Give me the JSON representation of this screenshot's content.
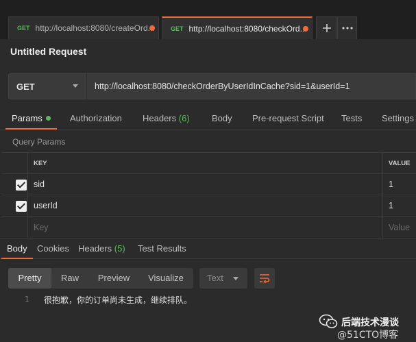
{
  "tabs": [
    {
      "method": "GET",
      "url": "http://localhost:8080/createOrd...",
      "unsaved": true,
      "active": false
    },
    {
      "method": "GET",
      "url": "http://localhost:8080/checkOrd...",
      "unsaved": true,
      "active": true
    }
  ],
  "tab_controls": {
    "new_tab_icon": "plus-icon",
    "more_icon": "ellipsis-icon"
  },
  "request": {
    "title": "Untitled Request",
    "method": "GET",
    "url": "http://localhost:8080/checkOrderByUserIdInCache?sid=1&userId=1"
  },
  "request_tabs": {
    "params": "Params",
    "authorization": "Authorization",
    "headers": "Headers",
    "headers_count": "(6)",
    "body": "Body",
    "prerequest": "Pre-request Script",
    "tests": "Tests",
    "settings": "Settings"
  },
  "query_params": {
    "label": "Query Params",
    "columns": {
      "key": "KEY",
      "value": "VALUE"
    },
    "rows": [
      {
        "checked": true,
        "key": "sid",
        "value": "1"
      },
      {
        "checked": true,
        "key": "userId",
        "value": "1"
      }
    ],
    "placeholder": {
      "key": "Key",
      "value": "Value"
    }
  },
  "response_tabs": {
    "body": "Body",
    "cookies": "Cookies",
    "headers": "Headers",
    "headers_count": "(5)",
    "test_results": "Test Results"
  },
  "format_bar": {
    "pretty": "Pretty",
    "raw": "Raw",
    "preview": "Preview",
    "visualize": "Visualize",
    "type_selected": "Text"
  },
  "response_body": {
    "line_number": "1",
    "text": "很抱歉，你的订单尚未生成，继续排队。"
  },
  "watermark": {
    "name": "后端技术漫谈",
    "site": "@51CTO博客"
  },
  "colors": {
    "accent": "#f26b3a",
    "method_green": "#5bb85b",
    "background": "#2b2b2b"
  }
}
